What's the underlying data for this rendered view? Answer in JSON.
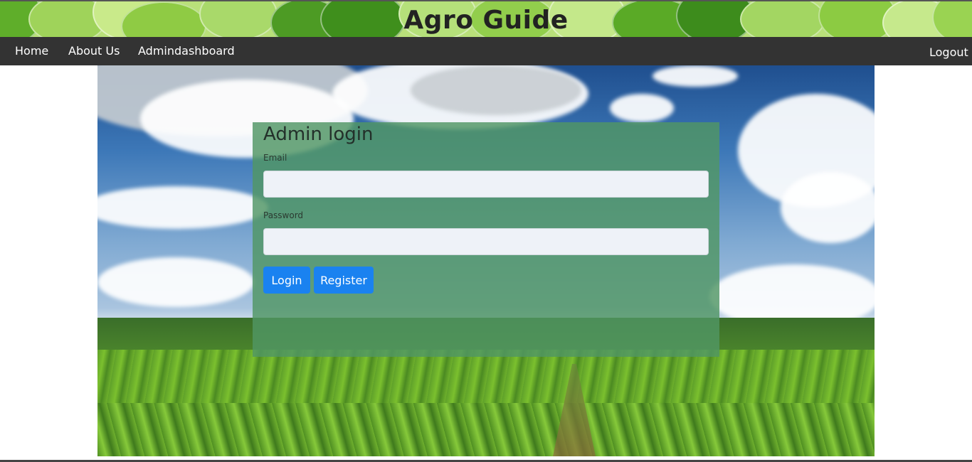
{
  "header": {
    "title": "Agro Guide"
  },
  "nav": {
    "items": [
      {
        "label": "Home"
      },
      {
        "label": "About Us"
      },
      {
        "label": "Admindashboard"
      }
    ],
    "logout_label": "Logout"
  },
  "login": {
    "title": "Admin login",
    "email": {
      "label": "Email",
      "value": "",
      "placeholder": ""
    },
    "password": {
      "label": "Password",
      "value": "",
      "placeholder": ""
    },
    "login_button": "Login",
    "register_button": "Register"
  },
  "colors": {
    "nav_bg": "#333333",
    "button": "#1a82f0",
    "panel": "#50966480",
    "banner_leaf_light": "#b9e07a",
    "banner_leaf_dark": "#3f8f1c"
  }
}
